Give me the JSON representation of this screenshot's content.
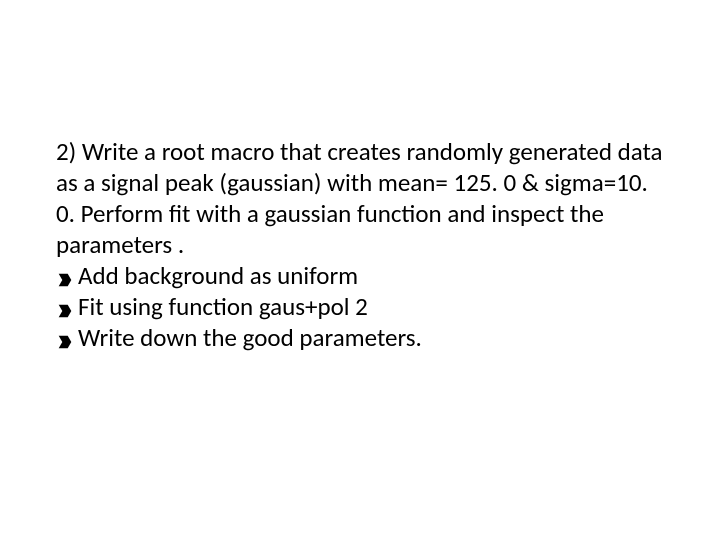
{
  "slide": {
    "main_text": "2)  Write a root macro that creates randomly generated data as a signal peak (gaussian) with mean= 125. 0 &  sigma=10. 0. Perform fit with a gaussian function and inspect the parameters .",
    "bullets": [
      "Add background as uniform",
      "Fit using function gaus+pol 2",
      "Write down the good parameters."
    ]
  }
}
